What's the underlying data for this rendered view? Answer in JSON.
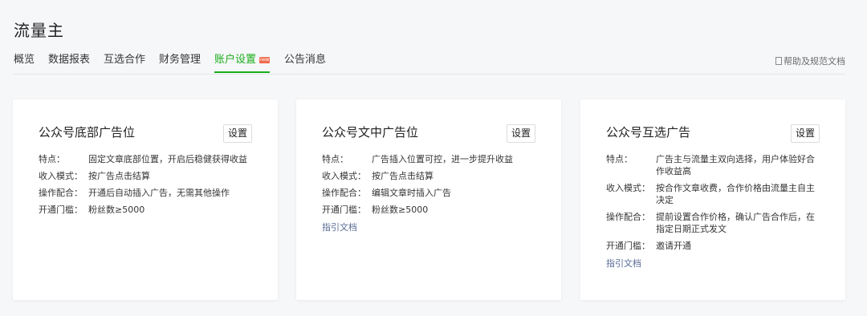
{
  "page_title": "流量主",
  "tabs": [
    {
      "label": "概览"
    },
    {
      "label": "数据报表"
    },
    {
      "label": "互选合作"
    },
    {
      "label": "财务管理"
    },
    {
      "label": "账户设置",
      "badge": "new",
      "active": true
    },
    {
      "label": "公告消息"
    }
  ],
  "help_link": "帮助及规范文档",
  "cards": [
    {
      "title": "公众号底部广告位",
      "button": "设置",
      "rows": [
        {
          "label": "特点：",
          "value": "固定文章底部位置，开启后稳健获得收益"
        },
        {
          "label": "收入模式：",
          "value": "按广告点击结算"
        },
        {
          "label": "操作配合：",
          "value": "开通后自动插入广告，无需其他操作"
        },
        {
          "label": "开通门槛：",
          "value": "粉丝数≥5000"
        }
      ]
    },
    {
      "title": "公众号文中广告位",
      "button": "设置",
      "rows": [
        {
          "label": "特点：",
          "value": "广告插入位置可控，进一步提升收益"
        },
        {
          "label": "收入模式：",
          "value": "按广告点击结算"
        },
        {
          "label": "操作配合：",
          "value": "编辑文章时插入广告"
        },
        {
          "label": "开通门槛：",
          "value": "粉丝数≥5000"
        }
      ],
      "guide": "指引文档"
    },
    {
      "title": "公众号互选广告",
      "button": "设置",
      "rows": [
        {
          "label": "特点：",
          "value": "广告主与流量主双向选择，用户体验好合作收益高"
        },
        {
          "label": "收入模式：",
          "value": "按合作文章收费，合作价格由流量主自主决定"
        },
        {
          "label": "操作配合：",
          "value": "提前设置合作价格，确认广告合作后，在指定日期正式发文"
        },
        {
          "label": "开通门槛：",
          "value": "邀请开通"
        }
      ],
      "guide": "指引文档"
    }
  ],
  "colors": {
    "accent": "#1aad19",
    "link": "#576b95",
    "badge": "#f06b4d"
  }
}
